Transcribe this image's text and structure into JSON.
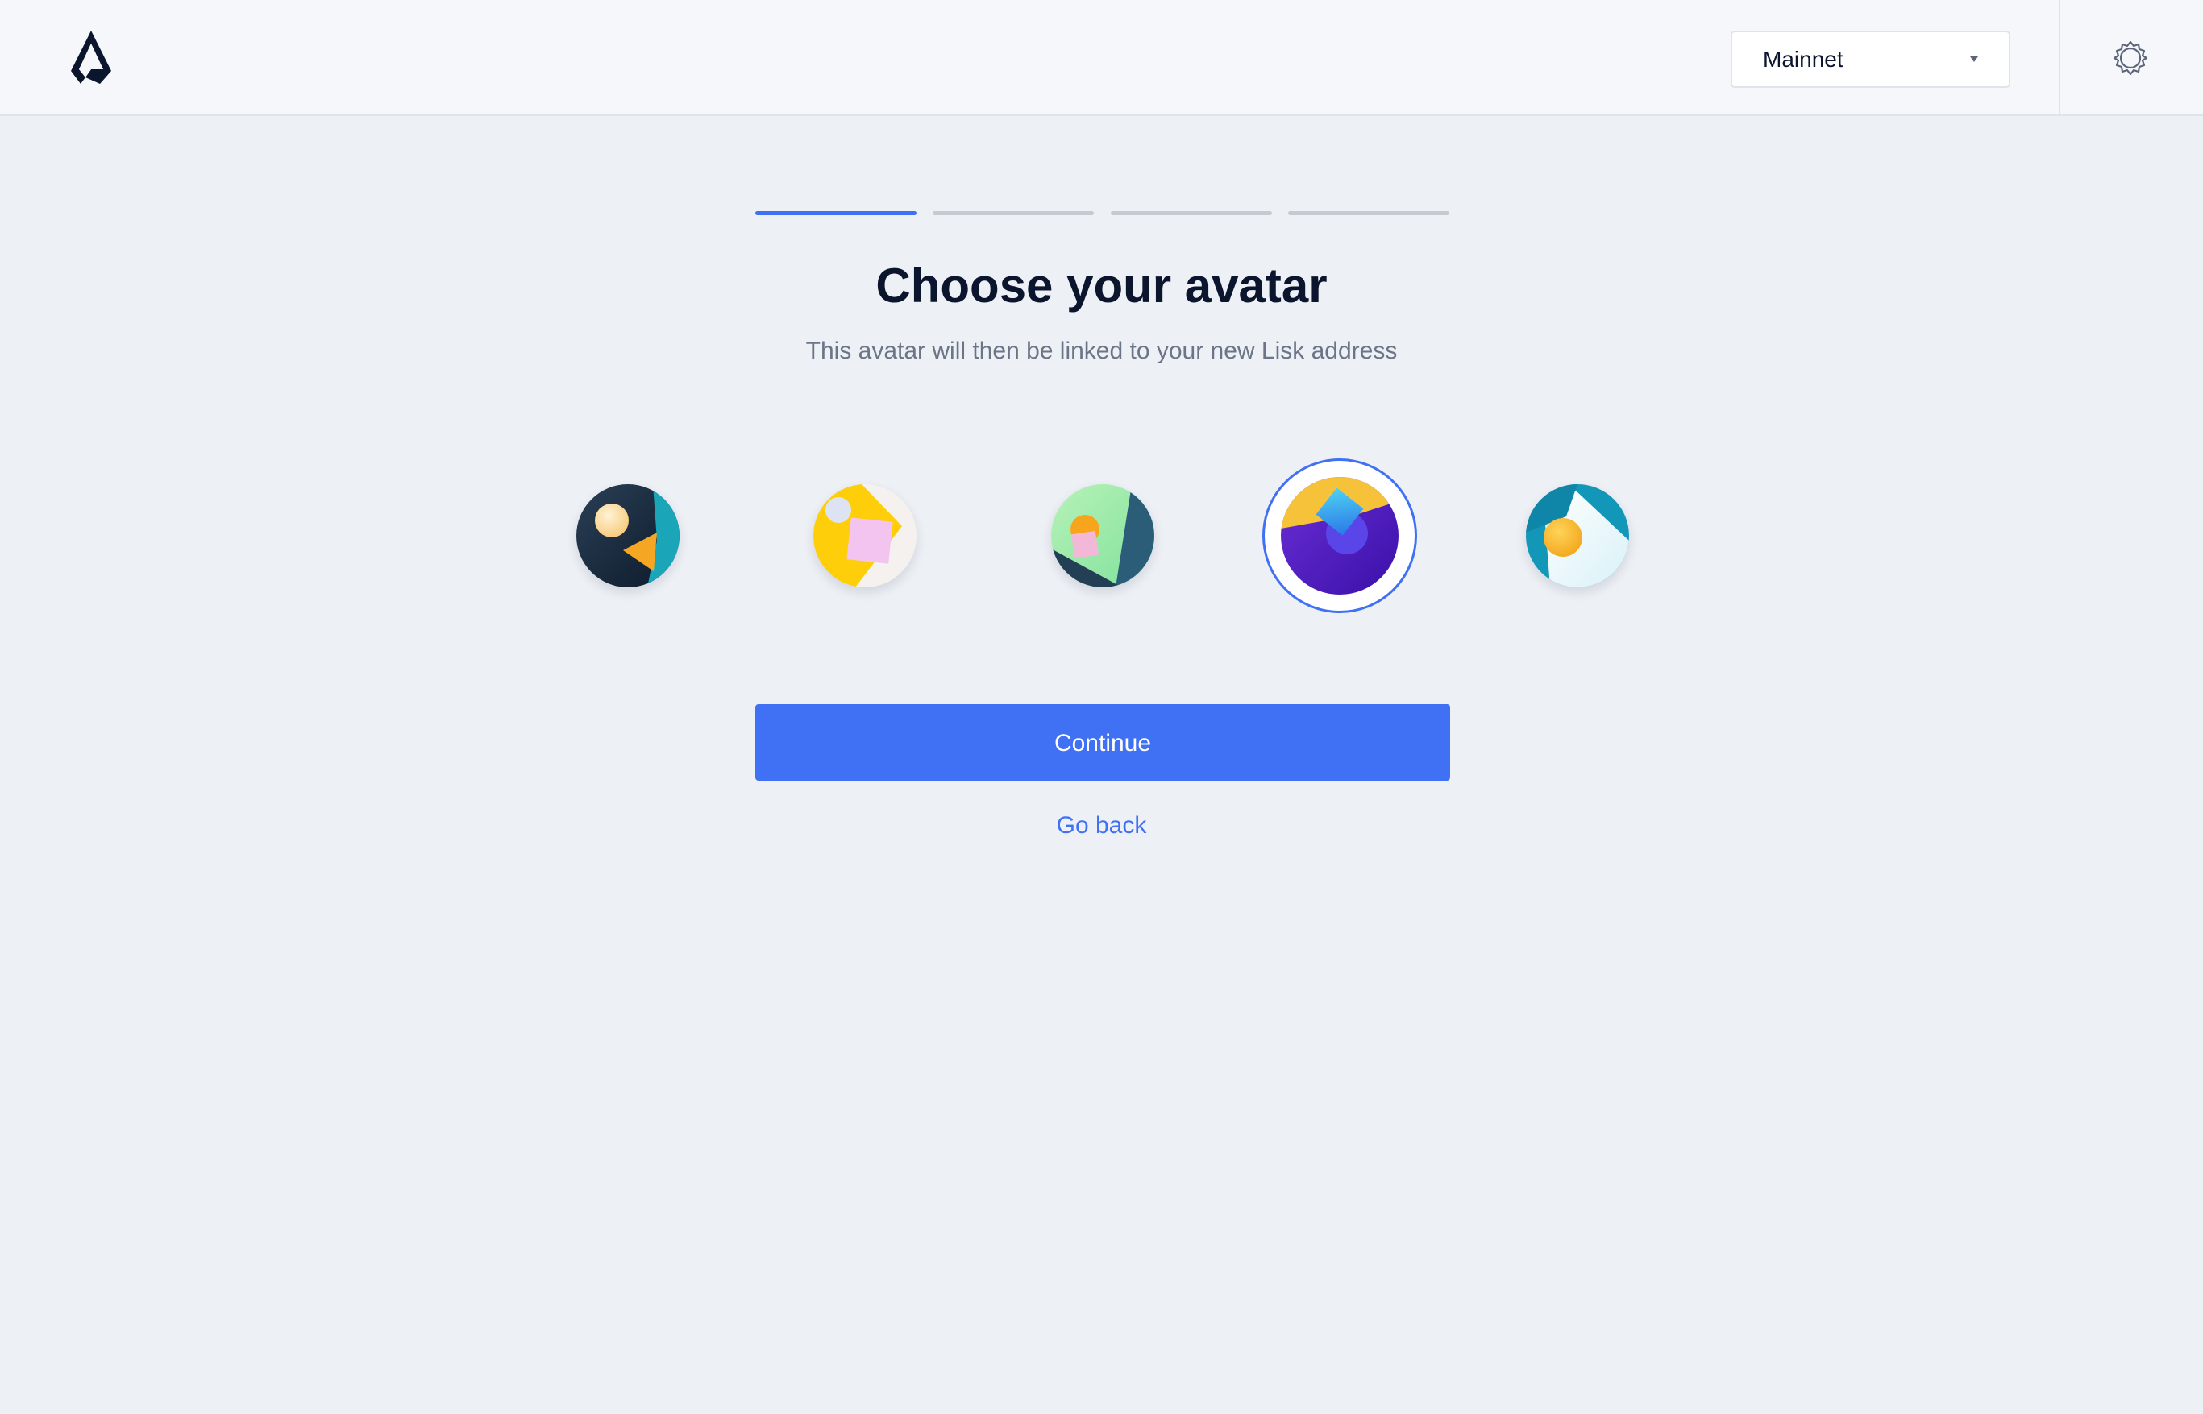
{
  "header": {
    "logo": "lisk-logo",
    "network_select": {
      "selected": "Mainnet",
      "icon": "caret-down-icon"
    },
    "settings_icon": "gear-icon"
  },
  "stepper": {
    "total_steps": 4,
    "current_step": 1
  },
  "main": {
    "title": "Choose your avatar",
    "subtitle": "This avatar will then be linked to your new Lisk address",
    "avatars": [
      {
        "selected": false
      },
      {
        "selected": false
      },
      {
        "selected": false
      },
      {
        "selected": true
      },
      {
        "selected": false
      }
    ],
    "continue_label": "Continue",
    "go_back_label": "Go back"
  },
  "colors": {
    "accent": "#4070f4",
    "background": "#edf0f5",
    "header_background": "#f5f7fa",
    "text_primary": "#0c152e",
    "text_secondary": "#6c7587"
  }
}
